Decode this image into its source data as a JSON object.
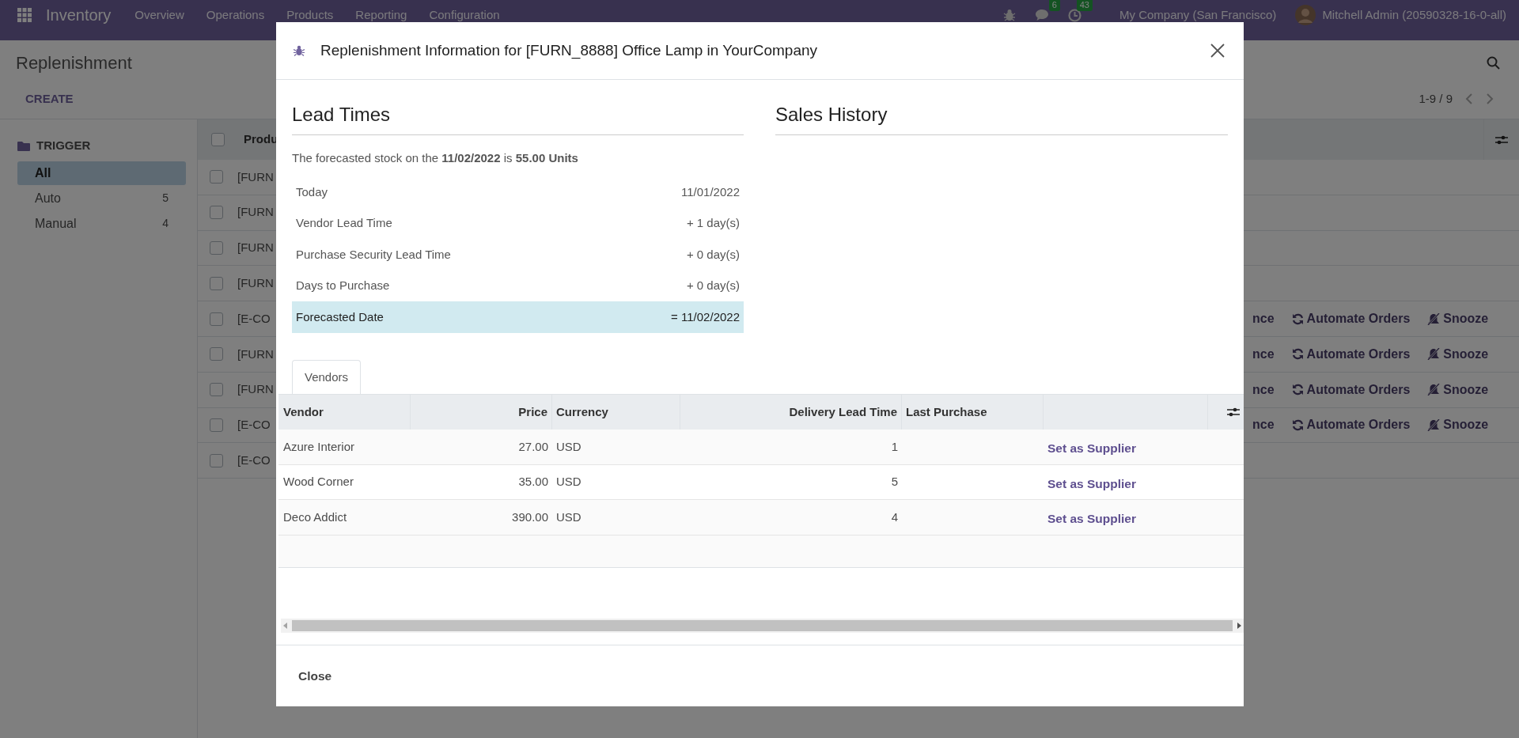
{
  "navbar": {
    "app": "Inventory",
    "menu": [
      "Overview",
      "Operations",
      "Products",
      "Reporting",
      "Configuration"
    ],
    "chat_count": "6",
    "activity_count": "43",
    "company": "My Company (San Francisco)",
    "user": "Mitchell Admin (20590328-16-0-all)"
  },
  "control_panel": {
    "title": "Replenishment",
    "create": "CREATE",
    "pager": "1-9 / 9"
  },
  "sidebar": {
    "heading": "TRIGGER",
    "items": [
      {
        "label": "All",
        "selected": true
      },
      {
        "label": "Auto",
        "count": "5",
        "selected": false
      },
      {
        "label": "Manual",
        "count": "4",
        "selected": false
      }
    ]
  },
  "list": {
    "header": "Produ",
    "header_checked": false,
    "rows": [
      {
        "product": "[FURN",
        "checked": false,
        "actions": []
      },
      {
        "product": "[FURN",
        "checked": false,
        "actions": []
      },
      {
        "product": "[FURN",
        "checked": false,
        "actions": []
      },
      {
        "product": "[FURN",
        "checked": false,
        "actions": []
      },
      {
        "product": "[E-CO",
        "checked": false,
        "actions": [
          {
            "kind": "order",
            "label": "nce"
          },
          {
            "kind": "automate",
            "label": "Automate Orders"
          },
          {
            "kind": "snooze",
            "label": "Snooze"
          }
        ]
      },
      {
        "product": "[FURN",
        "checked": false,
        "actions": [
          {
            "kind": "order",
            "label": "nce"
          },
          {
            "kind": "automate",
            "label": "Automate Orders"
          },
          {
            "kind": "snooze",
            "label": "Snooze"
          }
        ]
      },
      {
        "product": "[FURN",
        "checked": false,
        "actions": [
          {
            "kind": "order",
            "label": "nce"
          },
          {
            "kind": "automate",
            "label": "Automate Orders"
          },
          {
            "kind": "snooze",
            "label": "Snooze"
          }
        ]
      },
      {
        "product": "[E-CO",
        "checked": false,
        "actions": [
          {
            "kind": "order",
            "label": "nce"
          },
          {
            "kind": "automate",
            "label": "Automate Orders"
          },
          {
            "kind": "snooze",
            "label": "Snooze"
          }
        ]
      },
      {
        "product": "[E-CO",
        "checked": false,
        "actions": []
      }
    ]
  },
  "dialog": {
    "title": "Replenishment Information for [FURN_8888] Office Lamp in YourCompany",
    "lead_times": {
      "heading": "Lead Times",
      "summary": "The forecasted stock on the **11/02/2022** is **55.00 Units**",
      "rows": [
        {
          "label": "Today",
          "value": "11/01/2022",
          "highlighted": false
        },
        {
          "label": "Vendor Lead Time",
          "value": "+ 1 day(s)",
          "highlighted": false
        },
        {
          "label": "Purchase Security Lead Time",
          "value": "+ 0 day(s)",
          "highlighted": false
        },
        {
          "label": "Days to Purchase",
          "value": "+ 0 day(s)",
          "highlighted": false
        },
        {
          "label": "Forecasted Date",
          "value": "= 11/02/2022",
          "highlighted": true
        }
      ]
    },
    "sales_history": {
      "heading": "Sales History"
    },
    "tabs": [
      {
        "label": "Vendors",
        "selected": true
      }
    ],
    "vendors": {
      "columns": [
        "Vendor",
        "Price",
        "Currency",
        "Delivery Lead Time",
        "Last Purchase"
      ],
      "rows": [
        {
          "vendor": "Azure Interior",
          "price": "27.00",
          "currency": "USD",
          "lead_time": "1",
          "action": "Set as Supplier"
        },
        {
          "vendor": "Wood Corner",
          "price": "35.00",
          "currency": "USD",
          "lead_time": "5",
          "action": "Set as Supplier"
        },
        {
          "vendor": "Deco Addict",
          "price": "390.00",
          "currency": "USD",
          "lead_time": "4",
          "action": "Set as Supplier"
        }
      ]
    },
    "close": "Close"
  }
}
